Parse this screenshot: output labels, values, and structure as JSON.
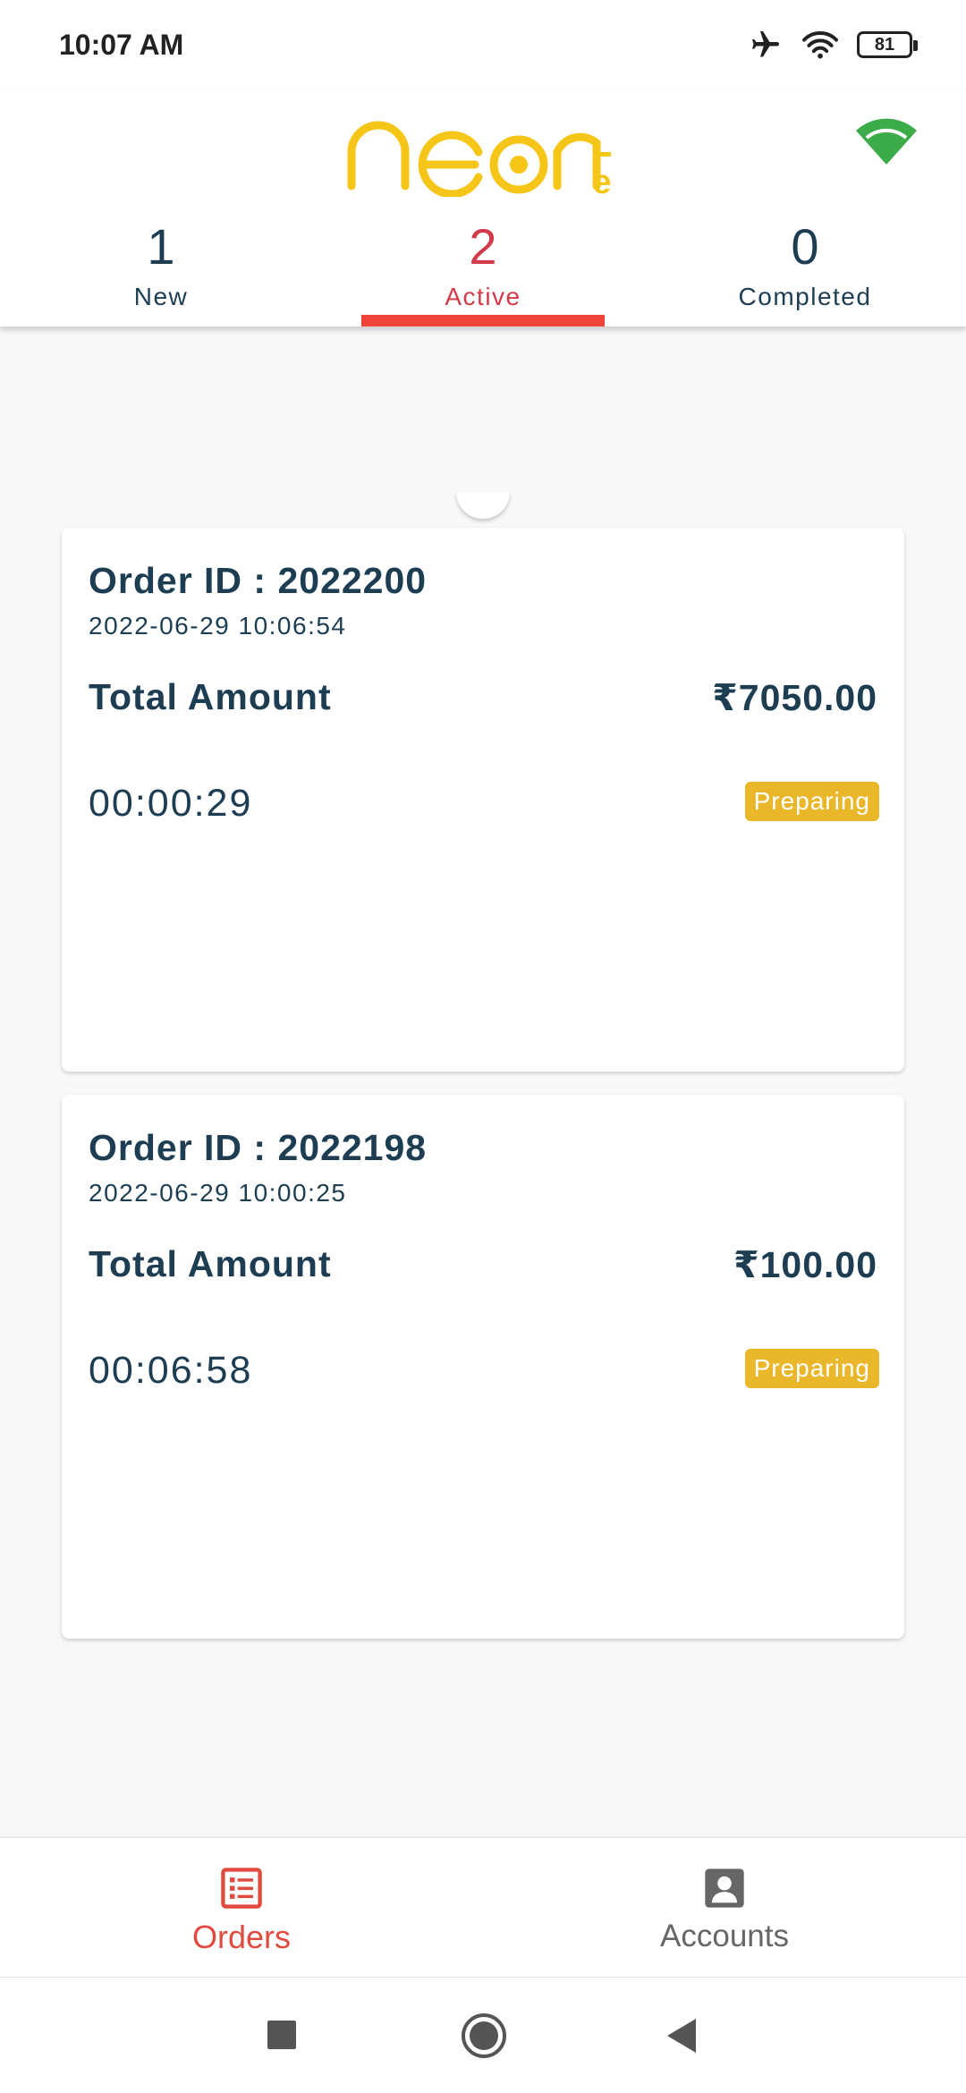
{
  "status_bar": {
    "time": "10:07 AM",
    "battery_level": "81",
    "icons": [
      "airplane-mode-icon",
      "wifi-icon",
      "battery-icon"
    ]
  },
  "header": {
    "logo_text": "NEON",
    "logo_superscript": "ē",
    "logo_color": "#f5c518",
    "connection_icon": "wifi-connected-icon",
    "connection_color": "#3cab4a"
  },
  "tabs": [
    {
      "count": "1",
      "label": "New",
      "selected": false
    },
    {
      "count": "2",
      "label": "Active",
      "selected": true
    },
    {
      "count": "0",
      "label": "Completed",
      "selected": false
    }
  ],
  "orders": [
    {
      "order_id": "Order ID : 2022200",
      "datetime": "2022-06-29 10:06:54",
      "total_label": "Total Amount",
      "total_value": "₹7050.00",
      "timer": "00:00:29",
      "status": "Preparing"
    },
    {
      "order_id": "Order ID : 2022198",
      "datetime": "2022-06-29 10:00:25",
      "total_label": "Total Amount",
      "total_value": "₹100.00",
      "timer": "00:06:58",
      "status": "Preparing"
    }
  ],
  "bottom_nav": [
    {
      "label": "Orders",
      "icon": "orders-list-icon",
      "selected": true
    },
    {
      "label": "Accounts",
      "icon": "account-icon",
      "selected": false
    }
  ],
  "system_nav": [
    "recents-square-icon",
    "home-circle-icon",
    "back-triangle-icon"
  ],
  "colors": {
    "text_primary": "#1d3d52",
    "accent_red": "#d23a49",
    "indicator_red": "#f04438",
    "badge_yellow": "#eab72a",
    "nav_active": "#e04a3f"
  }
}
